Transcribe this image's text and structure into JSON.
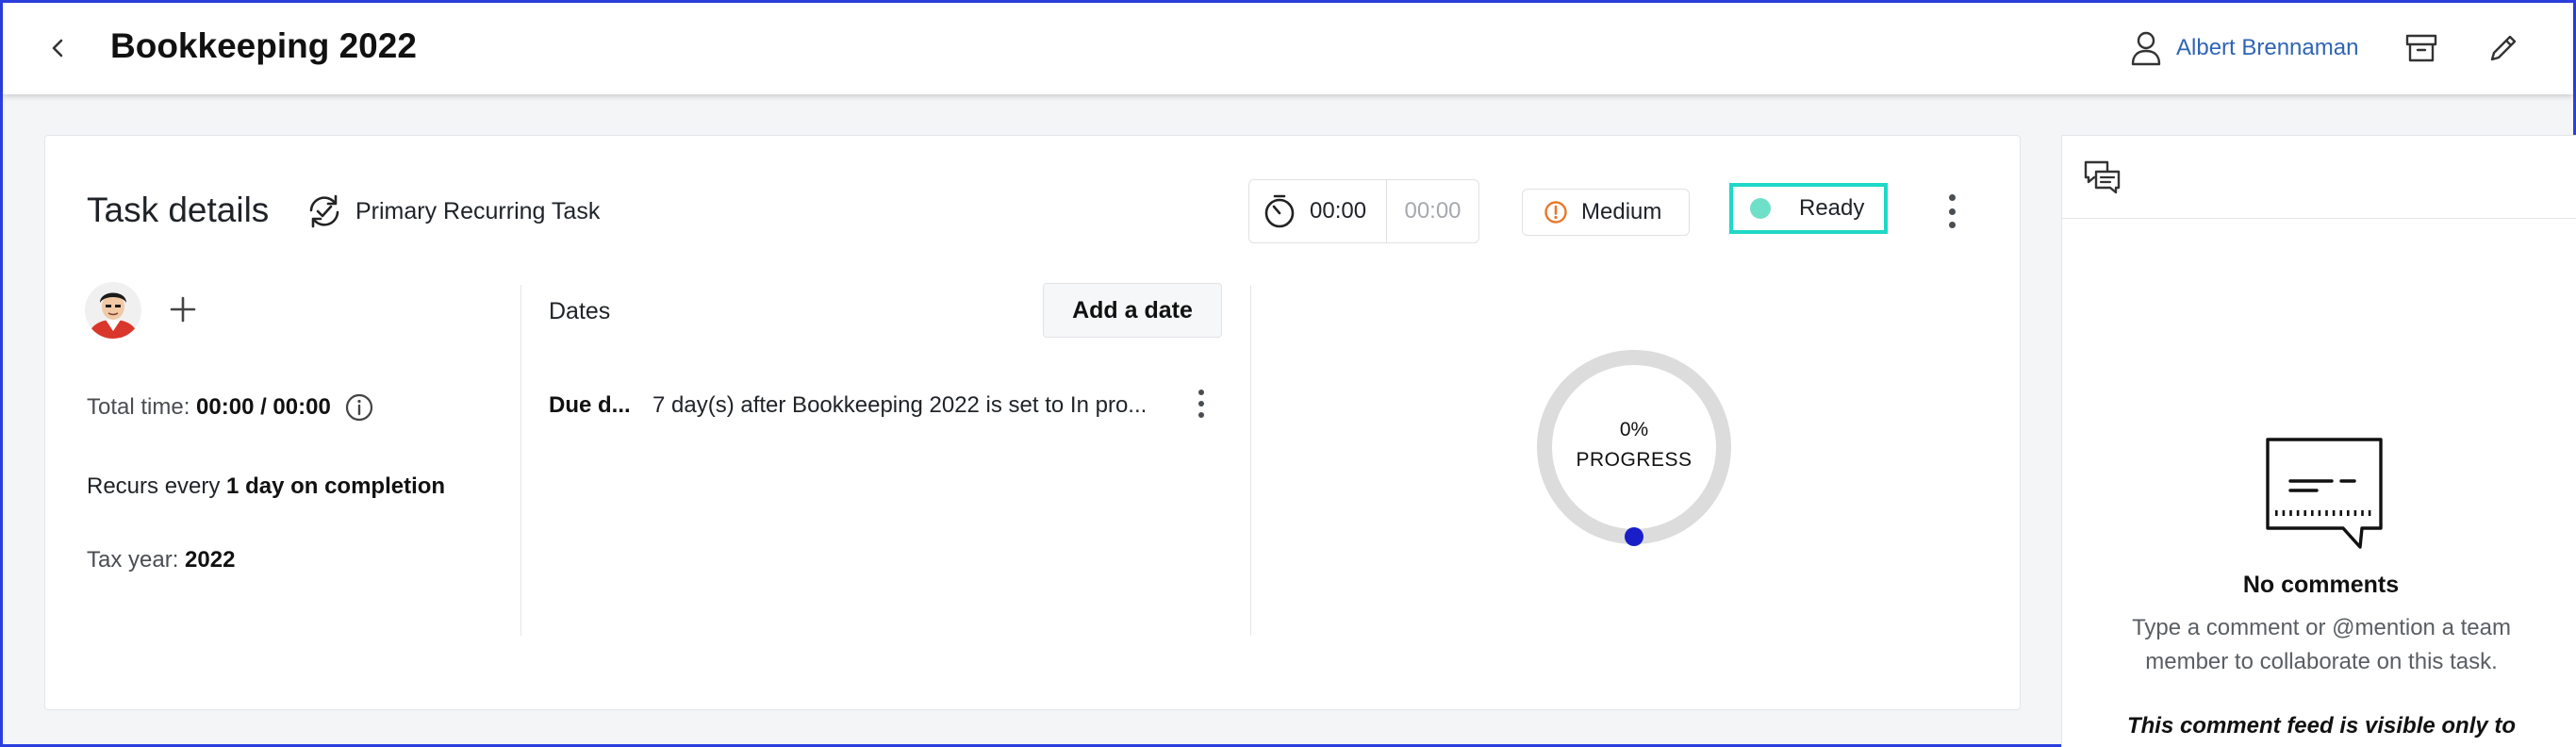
{
  "header": {
    "title": "Bookkeeping 2022",
    "user_name": "Albert Brennaman"
  },
  "task": {
    "heading": "Task details",
    "recurring_label": "Primary Recurring Task",
    "timer": {
      "elapsed": "00:00",
      "estimate": "00:00"
    },
    "priority": "Medium",
    "status": "Ready",
    "total_time": {
      "label": "Total time:",
      "value": "00:00 / 00:00"
    },
    "recurs": {
      "prefix": "Recurs every",
      "value": "1 day on completion"
    },
    "tax_year": {
      "label": "Tax year:",
      "value": "2022"
    }
  },
  "dates": {
    "label": "Dates",
    "add_button": "Add a date",
    "items": [
      {
        "label": "Due d...",
        "text": "7 day(s) after Bookkeeping 2022 is set to In pro..."
      }
    ]
  },
  "progress": {
    "percent_text": "0%",
    "label": "PROGRESS",
    "value": 0
  },
  "comments": {
    "empty_title": "No comments",
    "empty_description": "Type a comment or @mention a team member to collaborate on this task.",
    "visibility_note": "This comment feed is visible only to"
  },
  "colors": {
    "accent_blue": "#2f64b5",
    "status_highlight": "#1fd8c8",
    "status_dot": "#6fe0c8",
    "priority_orange": "#e8782a",
    "progress_track": "#dcdcdc",
    "progress_marker": "#1a1ec8",
    "window_border": "#2b3fe0"
  },
  "icons": {
    "back": "chevron-left-icon",
    "user": "user-icon",
    "archive": "archive-icon",
    "edit": "pencil-icon",
    "recurring": "recurring-icon",
    "timer": "stopwatch-icon",
    "priority": "alert-circle-icon",
    "info": "info-icon",
    "comments": "chat-bubbles-icon"
  }
}
